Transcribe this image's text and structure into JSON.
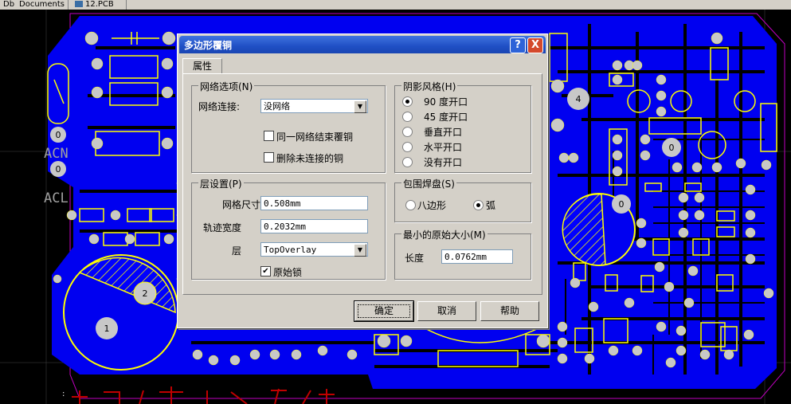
{
  "tabs": [
    "Db",
    "Documents",
    "12.PCB"
  ],
  "pcb": {
    "labels": [
      "ACN",
      "ACL"
    ],
    "pad_numbers": [
      "0",
      "0",
      "2",
      "1",
      "4",
      "0",
      "0"
    ]
  },
  "dialog": {
    "title": "多边形覆铜",
    "help_glyph": "?",
    "close_glyph": "X",
    "tab": "属性",
    "net_group": {
      "title": "网络选项(N)",
      "connect_label": "网络连接:",
      "connect_value": "没网络",
      "pour_same_net": "同一网络结束覆铜",
      "remove_dead": "删除未连接的铜",
      "pour_same_net_checked": false,
      "remove_dead_checked": false
    },
    "hatch_group": {
      "title": "阴影风格(H)",
      "options": [
        "90 度开口",
        "45 度开口",
        "垂直开口",
        "水平开口",
        "没有开口"
      ],
      "selected": 0
    },
    "layer_group": {
      "title": "层设置(P)",
      "grid_label": "网格尺寸",
      "grid_value": "0.508mm",
      "track_label": "轨迹宽度",
      "track_value": "0.2032mm",
      "layer_label": "层",
      "layer_value": "TopOverlay",
      "lock_label": "原始锁",
      "lock_checked": true
    },
    "surround_group": {
      "title": "包围焊盘(S)",
      "options": [
        "八边形",
        "弧"
      ],
      "selected": 1
    },
    "min_group": {
      "title": "最小的原始大小(M)",
      "length_label": "长度",
      "length_value": "0.0762mm"
    },
    "buttons": {
      "ok": "确定",
      "cancel": "取消",
      "help": "帮助"
    }
  }
}
